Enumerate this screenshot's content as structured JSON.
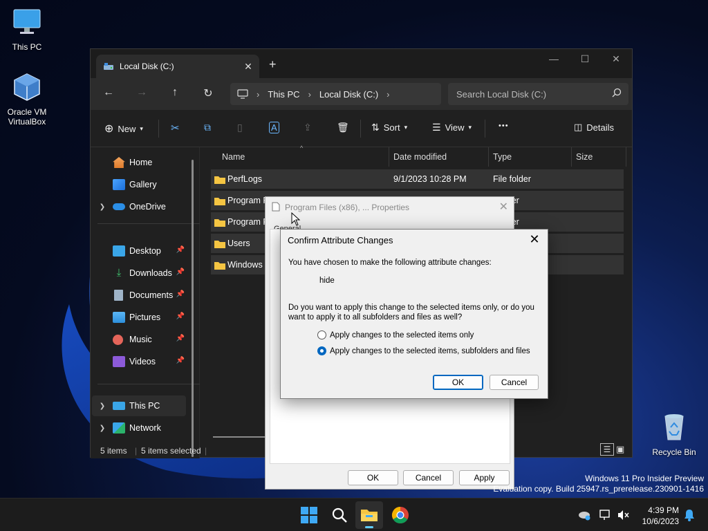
{
  "desktop": {
    "icons": [
      {
        "label": "This PC"
      },
      {
        "label": "Oracle VM VirtualBox"
      },
      {
        "label": "Recycle Bin"
      }
    ],
    "watermark": {
      "line1": "Windows 11 Pro Insider Preview",
      "line2": "Evaluation copy. Build 25947.rs_prerelease.230901-1416"
    }
  },
  "explorer": {
    "tab_title": "Local Disk (C:)",
    "breadcrumb": [
      "This PC",
      "Local Disk (C:)"
    ],
    "search_placeholder": "Search Local Disk (C:)",
    "toolbar": {
      "new_label": "New",
      "sort_label": "Sort",
      "view_label": "View",
      "more_label": "•••",
      "details_label": "Details"
    },
    "nav": {
      "items": [
        {
          "label": "Home"
        },
        {
          "label": "Gallery"
        },
        {
          "label": "OneDrive"
        },
        {
          "label": "Desktop"
        },
        {
          "label": "Downloads"
        },
        {
          "label": "Documents"
        },
        {
          "label": "Pictures"
        },
        {
          "label": "Music"
        },
        {
          "label": "Videos"
        },
        {
          "label": "This PC"
        },
        {
          "label": "Network"
        }
      ]
    },
    "columns": {
      "name": "Name",
      "date": "Date modified",
      "type": "Type",
      "size": "Size"
    },
    "files": [
      {
        "name": "PerfLogs",
        "date": "9/1/2023 10:28 PM",
        "type": "File folder"
      },
      {
        "name": "Program F",
        "date": "",
        "type": "lder"
      },
      {
        "name": "Program F",
        "date": "",
        "type": "lder"
      },
      {
        "name": "Users",
        "date": "",
        "type": ""
      },
      {
        "name": "Windows",
        "date": "",
        "type": ""
      }
    ],
    "status": {
      "count": "5 items",
      "selected": "5 items selected"
    }
  },
  "properties": {
    "title": "Program Files (x86), ... Properties",
    "tab_general": "General",
    "stubs": [
      "T",
      "L",
      "S",
      "S",
      "A"
    ],
    "ok_label": "OK",
    "cancel_label": "Cancel",
    "apply_label": "Apply"
  },
  "confirm": {
    "title": "Confirm Attribute Changes",
    "intro": "You have chosen to make the following attribute changes:",
    "change": "hide",
    "question_line1": "Do you want to apply this change to the selected items only, or do you",
    "question_line2": "want to apply it to all subfolders and files as well?",
    "option_selected_only": "Apply changes to the selected items only",
    "option_recursive": "Apply changes to the selected items, subfolders and files",
    "selected_option": "recursive",
    "ok_label": "OK",
    "cancel_label": "Cancel"
  },
  "taskbar": {
    "time": "4:39 PM",
    "date": "10/6/2023"
  },
  "colors": {
    "accent": "#0067c0",
    "folder": "#f5c542"
  }
}
